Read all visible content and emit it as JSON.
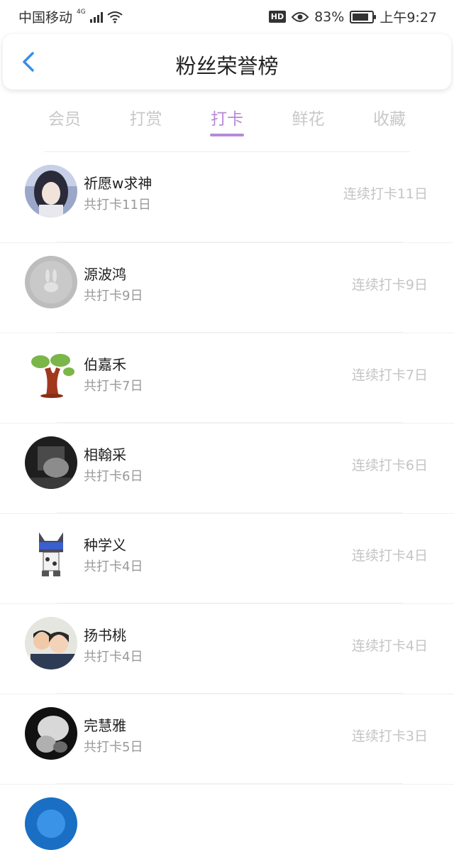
{
  "status": {
    "carrier": "中国移动",
    "network": "4G",
    "hd": "HD",
    "battery": "83%",
    "battery_level": 0.83,
    "time": "上午9:27"
  },
  "header": {
    "title": "粉丝荣誉榜",
    "back_icon": "chevron-left-icon"
  },
  "tabs": [
    {
      "label": "会员",
      "active": false
    },
    {
      "label": "打赏",
      "active": false
    },
    {
      "label": "打卡",
      "active": true
    },
    {
      "label": "鲜花",
      "active": false
    },
    {
      "label": "收藏",
      "active": false
    }
  ],
  "colors": {
    "accent": "#b78ad6",
    "back_icon": "#3a8ee6"
  },
  "list": [
    {
      "name": "祈愿w求神",
      "total": "共打卡11日",
      "streak": "连续打卡11日",
      "avatar": "anime-girl-avatar"
    },
    {
      "name": "源波鸿",
      "total": "共打卡9日",
      "streak": "连续打卡9日",
      "avatar": "gray-rabbit-avatar"
    },
    {
      "name": "伯嘉禾",
      "total": "共打卡7日",
      "streak": "连续打卡7日",
      "avatar": "tree-avatar"
    },
    {
      "name": "相翰采",
      "total": "共打卡6日",
      "streak": "连续打卡6日",
      "avatar": "dark-photo-avatar"
    },
    {
      "name": "种学义",
      "total": "共打卡4日",
      "streak": "连续打卡4日",
      "avatar": "cartoon-character-avatar"
    },
    {
      "name": "扬书桃",
      "total": "共打卡4日",
      "streak": "连续打卡4日",
      "avatar": "couple-photo-avatar"
    },
    {
      "name": "完慧雅",
      "total": "共打卡5日",
      "streak": "连续打卡3日",
      "avatar": "bw-photo-avatar"
    }
  ]
}
